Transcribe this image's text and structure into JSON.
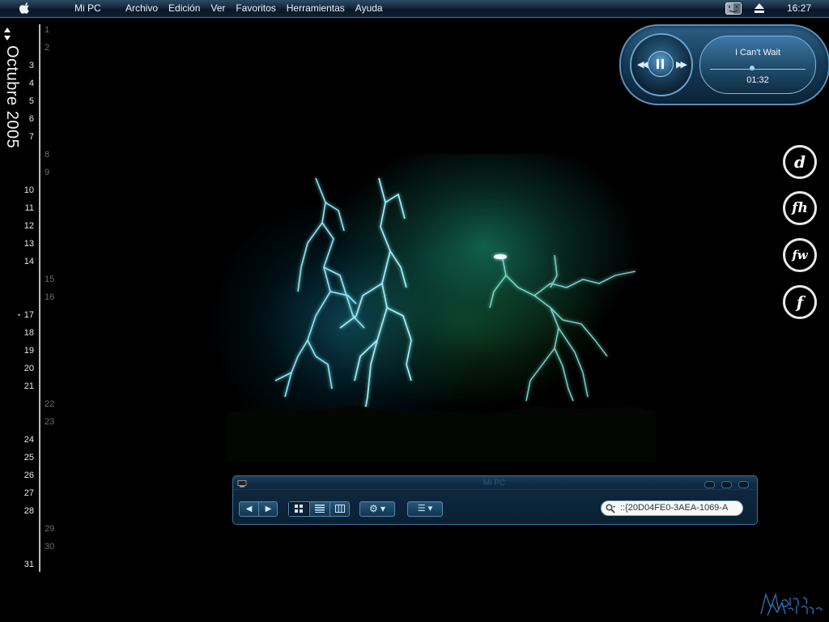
{
  "menubar": {
    "apple_icon": "apple-icon",
    "app_name": "Mi PC",
    "menus": [
      "Archivo",
      "Edición",
      "Ver",
      "Favoritos",
      "Herramientas",
      "Ayuda"
    ],
    "status_icons": [
      "finder-icon",
      "eject-icon"
    ],
    "clock": "16:27"
  },
  "calendar": {
    "month_label": "Octubre 2005",
    "days": [
      "1",
      "2",
      "3",
      "4",
      "5",
      "6",
      "7",
      "8",
      "9",
      "10",
      "11",
      "12",
      "13",
      "14",
      "15",
      "16",
      "17",
      "18",
      "19",
      "20",
      "21",
      "22",
      "23",
      "24",
      "25",
      "26",
      "27",
      "28",
      "29",
      "30",
      "31"
    ],
    "weekend_days": [
      "1",
      "2",
      "8",
      "9",
      "15",
      "16",
      "22",
      "23",
      "29",
      "30"
    ],
    "today": "17"
  },
  "player": {
    "track": "I Can't Wait",
    "time": "01:32",
    "buttons": [
      "previous",
      "pause",
      "next"
    ]
  },
  "dock": {
    "icons": [
      {
        "name": "dreamweaver-icon",
        "glyph": "d"
      },
      {
        "name": "fireworks-icon",
        "glyph": "fh"
      },
      {
        "name": "freehand-icon",
        "glyph": "fw"
      },
      {
        "name": "flash-icon",
        "glyph": "f"
      }
    ]
  },
  "finder": {
    "title": "Mi PC",
    "toolbar": {
      "back": "◀",
      "forward": "▶",
      "view_modes": [
        "icon-view",
        "list-view",
        "column-view"
      ],
      "action_menu": "⚙ ▾",
      "arrange_menu": "☰ ▾"
    },
    "search": {
      "value": "::{20D04FE0-3AEA-1069-A"
    }
  },
  "colors": {
    "menubar": "#14283c",
    "accent": "#3f6a93",
    "lightning": "#7ff4ff"
  }
}
